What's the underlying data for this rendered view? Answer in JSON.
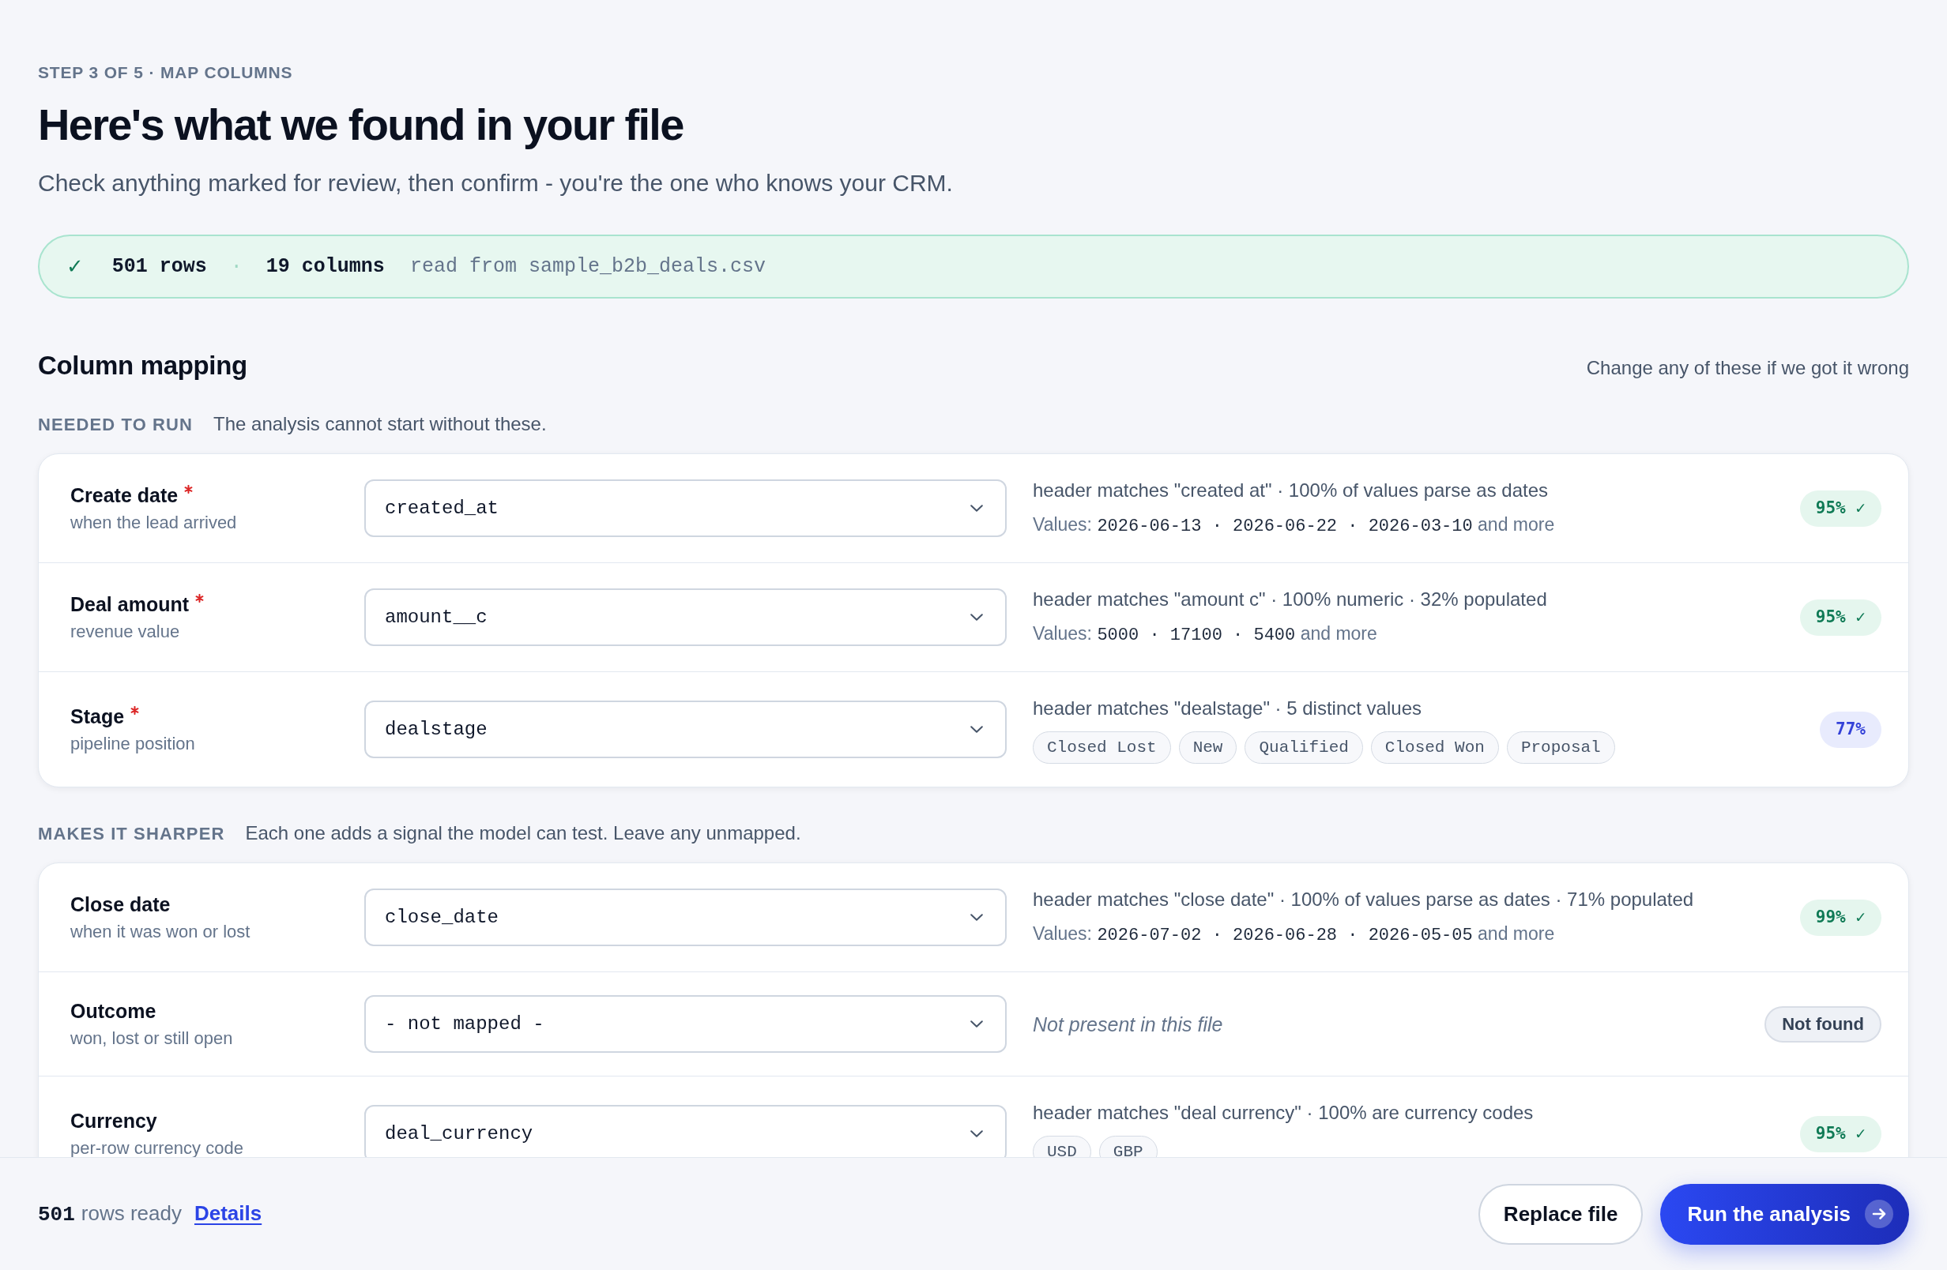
{
  "header": {
    "step": "STEP 3 OF 5 · MAP COLUMNS",
    "title": "Here's what we found in your file",
    "subtitle": "Check anything marked for review, then confirm - you're the one who knows your CRM."
  },
  "file_summary": {
    "check": "✓",
    "rows": "501 rows",
    "separator": "·",
    "columns": "19 columns",
    "source": "read from sample_b2b_deals.csv"
  },
  "mapping": {
    "title": "Column mapping",
    "hint": "Change any of these if we got it wrong",
    "groups": [
      {
        "label": "NEEDED TO RUN",
        "description": "The analysis cannot start without these.",
        "fields": [
          {
            "name": "Create date",
            "required": true,
            "description": "when the lead arrived",
            "column": "created_at",
            "kind": "values",
            "evidence": "header matches \"created at\" · 100% of values parse as dates",
            "values_label": "Values:",
            "values": "2026-06-13 · 2026-06-22 · 2026-03-10",
            "values_suffix": "and more",
            "confidence": {
              "label": "95% ✓",
              "kind": "matched"
            }
          },
          {
            "name": "Deal amount",
            "required": true,
            "description": "revenue value",
            "column": "amount__c",
            "kind": "values",
            "evidence": "header matches \"amount c\" · 100% numeric · 32% populated",
            "values_label": "Values:",
            "values": "5000 · 17100 · 5400",
            "values_suffix": "and more",
            "confidence": {
              "label": "95% ✓",
              "kind": "matched"
            }
          },
          {
            "name": "Stage",
            "required": true,
            "description": "pipeline position",
            "column": "dealstage",
            "kind": "chips",
            "evidence": "header matches \"dealstage\" · 5 distinct values",
            "chips": [
              "Closed Lost",
              "New",
              "Qualified",
              "Closed Won",
              "Proposal"
            ],
            "confidence": {
              "label": "77%",
              "kind": "review"
            }
          }
        ]
      },
      {
        "label": "MAKES IT SHARPER",
        "description": "Each one adds a signal the model can test. Leave any unmapped.",
        "fields": [
          {
            "name": "Close date",
            "required": false,
            "description": "when it was won or lost",
            "column": "close_date",
            "kind": "values",
            "evidence": "header matches \"close date\" · 100% of values parse as dates · 71% populated",
            "values_label": "Values:",
            "values": "2026-07-02 · 2026-06-28 · 2026-05-05",
            "values_suffix": "and more",
            "confidence": {
              "label": "99% ✓",
              "kind": "matched"
            }
          },
          {
            "name": "Outcome",
            "required": false,
            "description": "won, lost or still open",
            "column": "- not mapped -",
            "kind": "missing",
            "evidence": "Not present in this file",
            "confidence": {
              "label": "Not found",
              "kind": "missing"
            }
          },
          {
            "name": "Currency",
            "required": false,
            "description": "per-row currency code",
            "column": "deal_currency",
            "kind": "chips",
            "evidence": "header matches \"deal currency\" · 100% are currency codes",
            "chips": [
              "USD",
              "GBP"
            ],
            "confidence": {
              "label": "95% ✓",
              "kind": "matched"
            }
          }
        ]
      }
    ]
  },
  "footer": {
    "count": "501",
    "count_label": "rows ready",
    "link": "Details",
    "buttons": [
      {
        "label": "Replace file",
        "kind": "secondary"
      },
      {
        "label": "Run the analysis",
        "kind": "primary"
      }
    ]
  }
}
